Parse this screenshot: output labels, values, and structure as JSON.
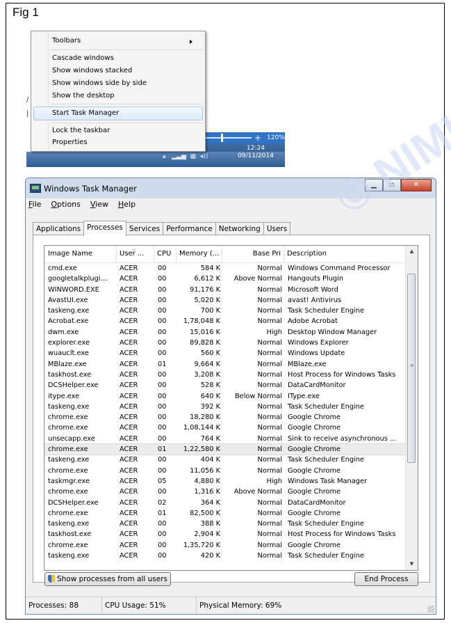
{
  "figure_label": "Fig 1",
  "watermark": "© NIMI NOT TO BE REPUBLISHED",
  "context_menu": {
    "items": [
      {
        "label": "Toolbars",
        "submenu": true
      },
      {
        "label": "Cascade windows"
      },
      {
        "label": "Show windows stacked"
      },
      {
        "label": "Show windows side by side"
      },
      {
        "label": "Show the desktop"
      },
      {
        "label": "Start Task Manager",
        "highlighted": true
      },
      {
        "label": "Lock the taskbar"
      },
      {
        "label": "Properties"
      }
    ],
    "zoom_level": "120%",
    "clock_time": "12:24",
    "clock_date": "09/11/2014"
  },
  "task_manager": {
    "title": "Windows Task Manager",
    "menu": [
      "File",
      "Options",
      "View",
      "Help"
    ],
    "tabs": [
      "Applications",
      "Processes",
      "Services",
      "Performance",
      "Networking",
      "Users"
    ],
    "active_tab": "Processes",
    "columns": [
      "Image Name",
      "User ...",
      "CPU",
      "Memory (...",
      "Base Pri",
      "Description"
    ],
    "processes": [
      [
        "cmd.exe",
        "ACER",
        "00",
        "584 K",
        "Normal",
        "Windows Command Processor"
      ],
      [
        "googletalkplugi...",
        "ACER",
        "00",
        "6,612 K",
        "Above Normal",
        "Hangouts Plugin"
      ],
      [
        "WINWORD.EXE",
        "ACER",
        "00",
        "91,176 K",
        "Normal",
        "Microsoft Word"
      ],
      [
        "AvastUI.exe",
        "ACER",
        "00",
        "5,020 K",
        "Normal",
        "avast! Antivirus"
      ],
      [
        "taskeng.exe",
        "ACER",
        "00",
        "700 K",
        "Normal",
        "Task Scheduler Engine"
      ],
      [
        "Acrobat.exe",
        "ACER",
        "00",
        "1,78,048 K",
        "Normal",
        "Adobe Acrobat"
      ],
      [
        "dwm.exe",
        "ACER",
        "00",
        "15,016 K",
        "High",
        "Desktop Window Manager"
      ],
      [
        "explorer.exe",
        "ACER",
        "00",
        "89,828 K",
        "Normal",
        "Windows Explorer"
      ],
      [
        "wuauclt.exe",
        "ACER",
        "00",
        "560 K",
        "Normal",
        "Windows Update"
      ],
      [
        "MBlaze.exe",
        "ACER",
        "01",
        "9,664 K",
        "Normal",
        "MBlaze.exe"
      ],
      [
        "taskhost.exe",
        "ACER",
        "00",
        "3,208 K",
        "Normal",
        "Host Process for Windows Tasks"
      ],
      [
        "DCSHelper.exe",
        "ACER",
        "00",
        "528 K",
        "Normal",
        "DataCardMonitor"
      ],
      [
        "itype.exe",
        "ACER",
        "00",
        "640 K",
        "Below Normal",
        "IType.exe"
      ],
      [
        "taskeng.exe",
        "ACER",
        "00",
        "392 K",
        "Normal",
        "Task Scheduler Engine"
      ],
      [
        "chrome.exe",
        "ACER",
        "00",
        "18,280 K",
        "Normal",
        "Google Chrome"
      ],
      [
        "chrome.exe",
        "ACER",
        "00",
        "1,08,144 K",
        "Normal",
        "Google Chrome"
      ],
      [
        "unsecapp.exe",
        "ACER",
        "00",
        "764 K",
        "Normal",
        "Sink to receive asynchronous ..."
      ],
      [
        "chrome.exe",
        "ACER",
        "01",
        "1,22,580 K",
        "Normal",
        "Google Chrome"
      ],
      [
        "taskeng.exe",
        "ACER",
        "00",
        "404 K",
        "Normal",
        "Task Scheduler Engine"
      ],
      [
        "chrome.exe",
        "ACER",
        "00",
        "11,056 K",
        "Normal",
        "Google Chrome"
      ],
      [
        "taskmgr.exe",
        "ACER",
        "05",
        "4,880 K",
        "High",
        "Windows Task Manager"
      ],
      [
        "chrome.exe",
        "ACER",
        "00",
        "1,316 K",
        "Above Normal",
        "Google Chrome"
      ],
      [
        "DCSHelper.exe",
        "ACER",
        "02",
        "364 K",
        "Normal",
        "DataCardMonitor"
      ],
      [
        "chrome.exe",
        "ACER",
        "01",
        "82,500 K",
        "Normal",
        "Google Chrome"
      ],
      [
        "taskeng.exe",
        "ACER",
        "00",
        "388 K",
        "Normal",
        "Task Scheduler Engine"
      ],
      [
        "taskhost.exe",
        "ACER",
        "00",
        "2,904 K",
        "Normal",
        "Host Process for Windows Tasks"
      ],
      [
        "chrome.exe",
        "ACER",
        "00",
        "1,35,720 K",
        "Normal",
        "Google Chrome"
      ],
      [
        "taskeng.exe",
        "ACER",
        "00",
        "420 K",
        "Normal",
        "Task Scheduler Engine"
      ]
    ],
    "selected_row": 17,
    "show_all_button": "Show processes from all users",
    "end_process_button": "End Process",
    "status": {
      "processes": "Processes: 88",
      "cpu": "CPU Usage: 51%",
      "memory": "Physical Memory: 69%"
    }
  }
}
